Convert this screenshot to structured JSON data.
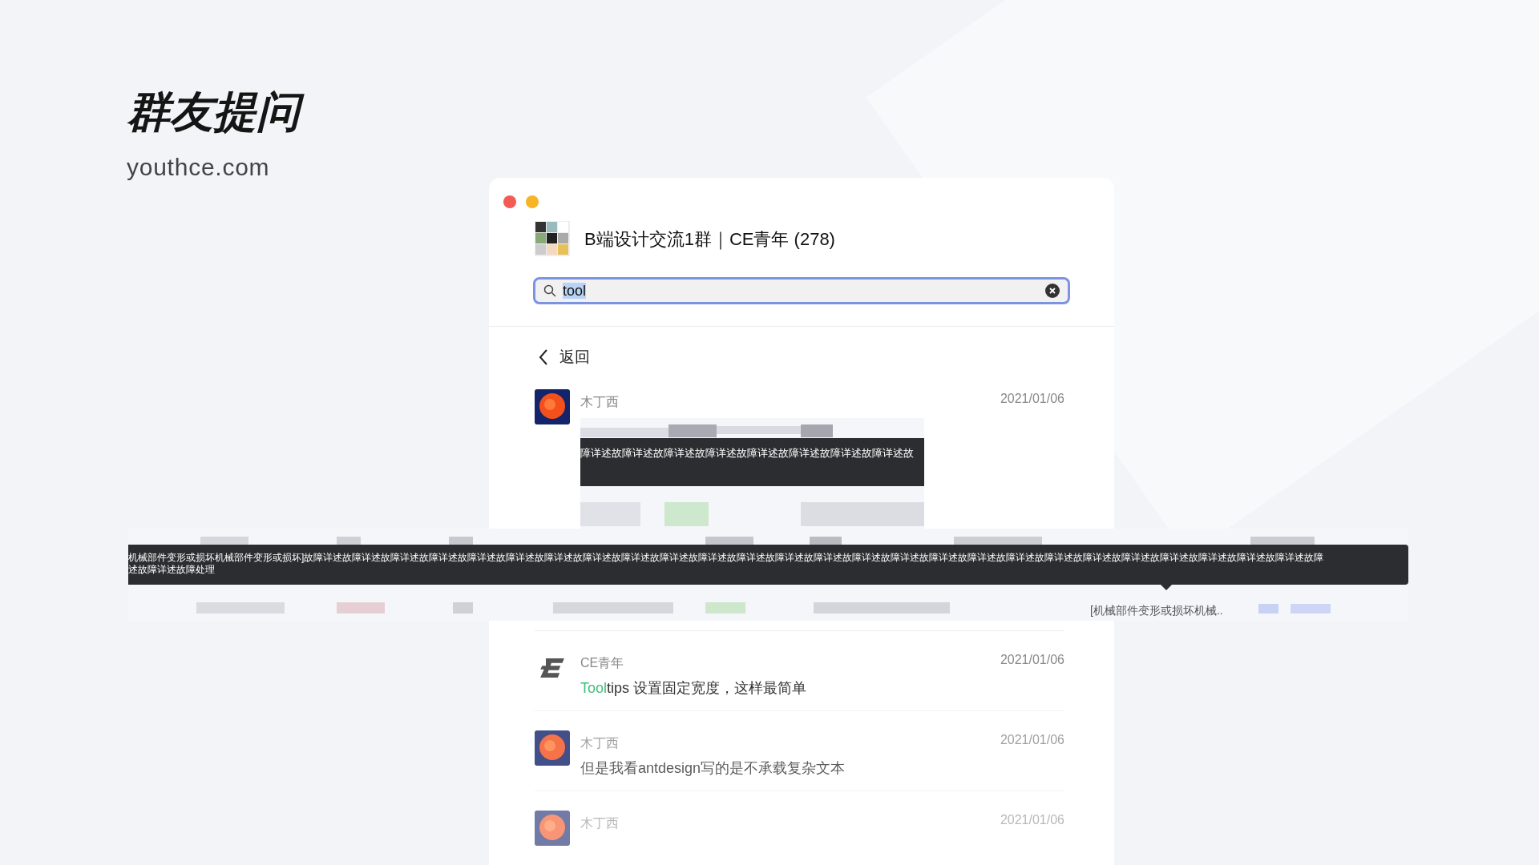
{
  "slide": {
    "title": "群友提问",
    "subtitle": "youthce.com"
  },
  "window": {
    "title": "B端设计交流1群｜CE青年 (278)",
    "search": {
      "value": "tool"
    },
    "back": "返回",
    "messages": [
      {
        "author": "木丁西",
        "date": "2021/01/06",
        "avatar": {
          "kind": "orange"
        },
        "tooltip": "障详述故障详述故障详述故障详述故障详述故障详述故障详述故障详述故"
      },
      {
        "kind": "text",
        "author": "CE青年",
        "date": "2021/01/06",
        "avatar": {
          "kind": "logo"
        },
        "parts": [
          {
            "text": "Tool",
            "match": true
          },
          {
            "text": "tips 设置固定宽度，这样最简单",
            "match": false
          }
        ]
      },
      {
        "kind": "text",
        "author": "木丁西",
        "date": "2021/01/06",
        "avatar": {
          "kind": "orange"
        },
        "parts": [
          {
            "text": "但是我看antdesign写的是不承载复杂文本",
            "match": false
          }
        ]
      },
      {
        "kind": "header",
        "author": "木丁西",
        "date": "2021/01/06",
        "avatar": {
          "kind": "orange"
        }
      }
    ]
  },
  "overlay": {
    "tooltip_lines": [
      "机械部件变形或损坏机械部件变形或损坏]故障详述故障详述故障详述故障详述故障详述故障详述故障详述故障详述故障详述故障详述故障详述故障详述故障详述故障详述故障详述故障详述故障详述故障详述故障详述故障详述故障详述故障详述故障详述故障详述故障详述故障详述故障",
      "述故障详述故障处理"
    ],
    "cell": "[机械部件变形或损坏机械.."
  }
}
